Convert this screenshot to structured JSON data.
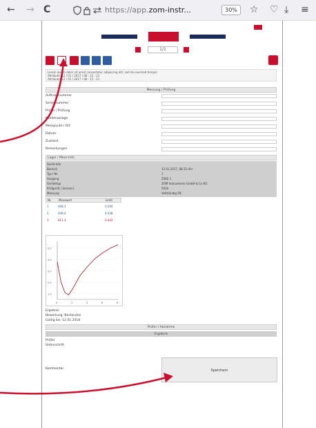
{
  "browser": {
    "back_icon": "←",
    "forward_icon": "→",
    "reload_icon": "C",
    "url_prefix": "https://app.",
    "url_domain": "zom-instr...",
    "zoom_level": "30%",
    "star_icon": "☆",
    "pocket_icon": "♡",
    "download_icon": "⤓",
    "menu_icon": "≡"
  },
  "page": {
    "pager_value": "1/1",
    "info_lines": [
      "Lorem ipsum dolor sit amet consectetur adipiscing elit, sed do eiusmod tempor",
      "Attribute: 12 / 01 / 2017 / 08 : 15 : 21",
      "Attribute: 12 / 01 / 2017 / 08 : 15 : 21"
    ],
    "section1_title": "Messung / Prüfung",
    "rows": [
      "Auftragsnummer",
      "Seriennummer",
      "Prüfer / Prüfung",
      "Kundenanlage",
      "Messpunkt / Ort",
      "Datum",
      "Zustand",
      "Bemerkungen"
    ],
    "section2_title": "Lager / Mess-Info",
    "grey_left": [
      "Gerät-Info",
      "Bereich",
      "Typ / Nr.",
      "Ausgang",
      "Gerätetyp",
      "Prüfgerät / Seriennr.",
      "Messung"
    ],
    "grey_right": [
      "12.01.2017, 08:15 Uhr",
      "1",
      "ZSKE 1",
      "ZOM Instruments GmbH & Co KG",
      "5020",
      "Vollständig OK"
    ],
    "table_headers": [
      "Nr.",
      "Messwert",
      "Limit"
    ],
    "table_rows": [
      [
        "1",
        "408.1",
        "0.440"
      ],
      [
        "2",
        "408.4",
        "0.438"
      ],
      [
        "3",
        "411.3",
        "0.442"
      ]
    ],
    "chart_yticks": [
      "5.0",
      "4.0",
      "3.0",
      "2.0",
      "1.0"
    ],
    "chart_xticks": [
      "0",
      "2",
      "4",
      "6",
      "8"
    ],
    "below_chart": [
      "Ergebnis",
      "Bewertung: Bestanden",
      "Gültig bis: 12.01.2018"
    ],
    "section3_title": "Prüfer / Abnahme",
    "section3_sub": "Ergebnis",
    "sign_rows": [
      "Prüfer",
      "Unterschrift"
    ],
    "field_label": "Kommentar",
    "submit_label": "Speichern"
  },
  "colors": {
    "accent_red": "#c8102e",
    "navy": "#1a2a5a",
    "toolbar_blue": "#2f5da0",
    "curve": "#a22a3a",
    "table_blue": "#2f5da0",
    "table_red": "#c8102e"
  },
  "chart_data": {
    "type": "line",
    "x": [
      0,
      0.5,
      1,
      1.5,
      2,
      3,
      4,
      5,
      6,
      7,
      8
    ],
    "y": [
      3.8,
      2.0,
      1.1,
      0.9,
      1.4,
      2.6,
      3.4,
      4.1,
      4.6,
      5.0,
      5.3
    ],
    "ylim": [
      0.5,
      5.6
    ],
    "xlim": [
      0,
      8
    ]
  }
}
